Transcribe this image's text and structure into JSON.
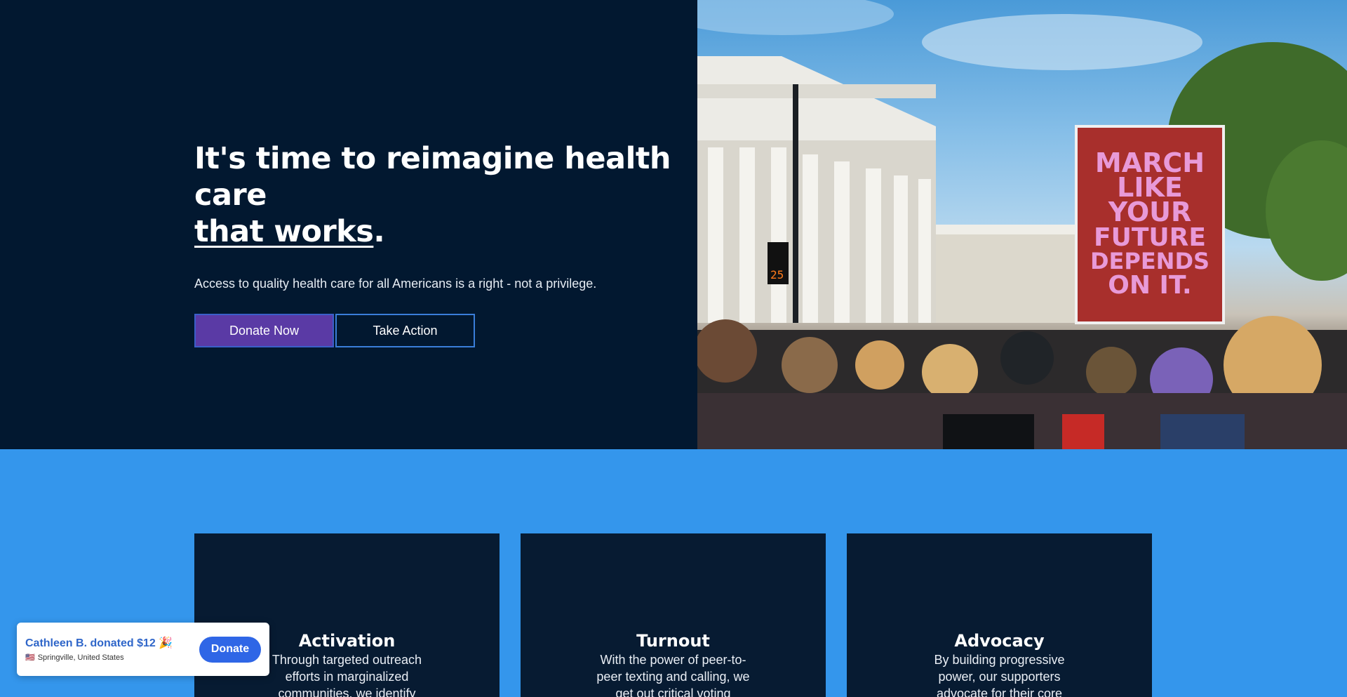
{
  "hero": {
    "title_part1": "It's time to reimagine health care",
    "title_underlined": "that works",
    "title_end": ".",
    "subtitle": "Access to quality health care for all Americans is a right - not a privilege.",
    "donate_label": "Donate Now",
    "action_label": "Take Action",
    "colors": {
      "background": "#021830",
      "donate": "#5a3aa5",
      "accent": "#3a7ed9"
    }
  },
  "photo": {
    "description_icon": "protest-photo",
    "sign_lines": [
      "MARCH",
      "LIKE",
      "YOUR",
      "FUTURE",
      "DEPENDS",
      "ON IT."
    ],
    "crosswalk_number": "25"
  },
  "cards": [
    {
      "title": "Activation",
      "body": "Through targeted outreach efforts in marginalized communities, we identify"
    },
    {
      "title": "Turnout",
      "body": "With the power of peer-to-peer texting and calling, we get out critical voting"
    },
    {
      "title": "Advocacy",
      "body": "By building progressive power, our supporters advocate for their core"
    }
  ],
  "toast": {
    "title": "Cathleen B. donated $12 🎉",
    "flag": "🇺🇸",
    "location": "Springville, United States",
    "button": "Donate"
  },
  "section_bg": "#3496ec"
}
